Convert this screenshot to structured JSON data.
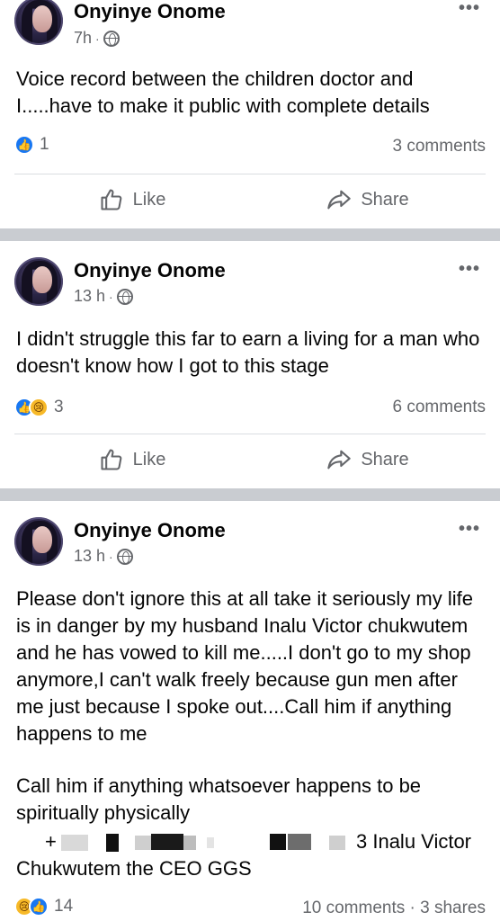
{
  "posts": [
    {
      "author": "Onyinye Onome",
      "time": "7h",
      "text": "Voice record between the children doctor and I.....have to make it public with complete details",
      "reaction_count": "1",
      "comments": "3 comments"
    },
    {
      "author": "Onyinye Onome",
      "time": "13 h",
      "text": "I didn't struggle this far to earn a living for a man who doesn't know how I got to this stage",
      "reaction_count": "3",
      "comments": "6 comments"
    },
    {
      "author": "Onyinye Onome",
      "time": "13 h",
      "text_p1": "Please don't ignore this at all take it seriously my life is in danger by my husband Inalu Victor chukwutem and he has vowed to kill me.....I don't go to my shop anymore,I can't walk freely because gun men after me just because I spoke out....Call him if anything happens to me",
      "text_p2": "Call him if anything whatsoever happens to be spiritually physically",
      "phone_prefix": "+",
      "phone_suffix": "3 Inalu Victor",
      "text_p3": "Chukwutem the CEO GGS",
      "reaction_count": "14",
      "comments": "10 comments",
      "shares": "3 shares"
    }
  ],
  "actions": {
    "like": "Like",
    "share": "Share"
  },
  "more_icon": "•••",
  "meta_dot": "·",
  "colors": {
    "like_blue": "#1877f2",
    "sad_yellow": "#f7b928",
    "separator": "#c9ccd1",
    "secondary_text": "#65676b"
  }
}
